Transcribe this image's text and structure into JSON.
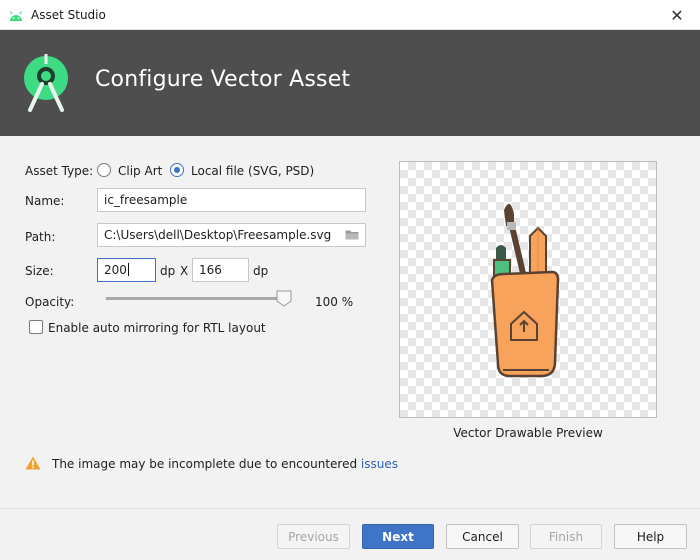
{
  "window": {
    "title": "Asset Studio",
    "close_glyph": "✕"
  },
  "header": {
    "title": "Configure Vector Asset"
  },
  "form": {
    "asset_type_label": "Asset Type:",
    "asset_type_options": [
      "Clip Art",
      "Local file (SVG, PSD)"
    ],
    "asset_type_selected": "Local file (SVG, PSD)",
    "name_label": "Name:",
    "name_value": "ic_freesample",
    "path_label": "Path:",
    "path_value": "C:\\Users\\dell\\Desktop\\Freesample.svg",
    "size_label": "Size:",
    "width_value": "200",
    "width_unit": "dp",
    "size_separator": "X",
    "height_value": "166",
    "height_unit": "dp",
    "opacity_label": "Opacity:",
    "opacity_value": "100 %",
    "opacity_fraction": 1.0,
    "rtl_label": "Enable auto mirroring for RTL layout",
    "rtl_checked": false
  },
  "preview": {
    "label": "Vector Drawable Preview"
  },
  "warning": {
    "text": "The image may be incomplete due to encountered ",
    "link": "issues"
  },
  "buttons": {
    "previous": "Previous",
    "next": "Next",
    "cancel": "Cancel",
    "finish": "Finish",
    "help": "Help"
  },
  "colors": {
    "header_bg": "#4e4e4e",
    "accent": "#3f74c6",
    "warning": "#f0a030",
    "preview_fill": "#f7a35c"
  }
}
